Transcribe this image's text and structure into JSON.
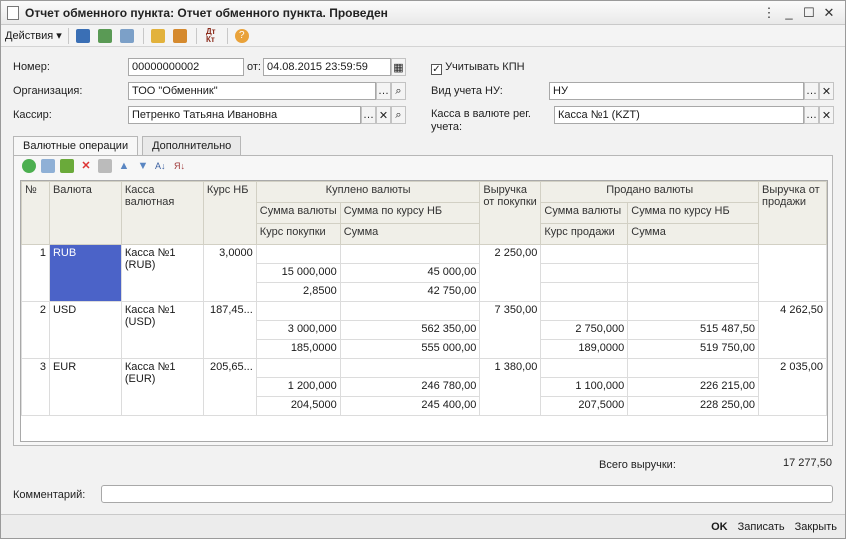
{
  "window": {
    "title": "Отчет обменного пункта: Отчет обменного пункта. Проведен"
  },
  "toolbar": {
    "actions_label": "Действия"
  },
  "form": {
    "number_label": "Номер:",
    "number_value": "00000000002",
    "date_label": "от:",
    "date_value": "04.08.2015 23:59:59",
    "kpn_label": "Учитывать КПН",
    "org_label": "Организация:",
    "org_value": "ТОО \"Обменник\"",
    "nu_label": "Вид учета НУ:",
    "nu_value": "НУ",
    "cashier_label": "Кассир:",
    "cashier_value": "Петренко Татьяна Ивановна",
    "kassa_label_1": "Касса в валюте рег.",
    "kassa_label_2": "учета:",
    "kassa_value": "Касса №1 (KZT)"
  },
  "tabs": [
    "Валютные операции",
    "Дополнительно"
  ],
  "table": {
    "headers": {
      "num": "№",
      "currency": "Валюта",
      "kassa": "Касса валютная",
      "rate": "Курс НБ",
      "bought": "Куплено валюты",
      "bought_amount": "Сумма валюты",
      "bought_nb_sum": "Сумма по курсу НБ",
      "buy_rate": "Курс покупки",
      "sum": "Сумма",
      "revenue_buy": "Выручка от покупки",
      "sold": "Продано валюты",
      "sold_amount": "Сумма валюты",
      "sold_nb_sum": "Сумма по курсу НБ",
      "sell_rate": "Курс продажи",
      "sold_sum": "Сумма",
      "revenue_sell": "Выручка от продажи"
    },
    "rows": [
      {
        "num": "1",
        "currency": "RUB",
        "kassa": "Касса №1 (RUB)",
        "rate": "3,0000",
        "b_amount": "15 000,000",
        "b_nb": "45 000,00",
        "b_rate": "2,8500",
        "b_sum": "42 750,00",
        "rev_buy": "2 250,00",
        "s_amount": "",
        "s_nb": "",
        "s_rate": "",
        "s_sum": "",
        "rev_sell": ""
      },
      {
        "num": "2",
        "currency": "USD",
        "kassa": "Касса №1 (USD)",
        "rate": "187,45...",
        "b_amount": "3 000,000",
        "b_nb": "562 350,00",
        "b_rate": "185,0000",
        "b_sum": "555 000,00",
        "rev_buy": "7 350,00",
        "s_amount": "2 750,000",
        "s_nb": "515 487,50",
        "s_rate": "189,0000",
        "s_sum": "519 750,00",
        "rev_sell": "4 262,50"
      },
      {
        "num": "3",
        "currency": "EUR",
        "kassa": "Касса №1 (EUR)",
        "rate": "205,65...",
        "b_amount": "1 200,000",
        "b_nb": "246 780,00",
        "b_rate": "204,5000",
        "b_sum": "245 400,00",
        "rev_buy": "1 380,00",
        "s_amount": "1 100,000",
        "s_nb": "226 215,00",
        "s_rate": "207,5000",
        "s_sum": "228 250,00",
        "rev_sell": "2 035,00"
      }
    ]
  },
  "totals": {
    "label": "Всего выручки:",
    "value": "17 277,50"
  },
  "comment": {
    "label": "Комментарий:",
    "value": ""
  },
  "footer": {
    "ok": "OK",
    "save": "Записать",
    "close": "Закрыть"
  }
}
